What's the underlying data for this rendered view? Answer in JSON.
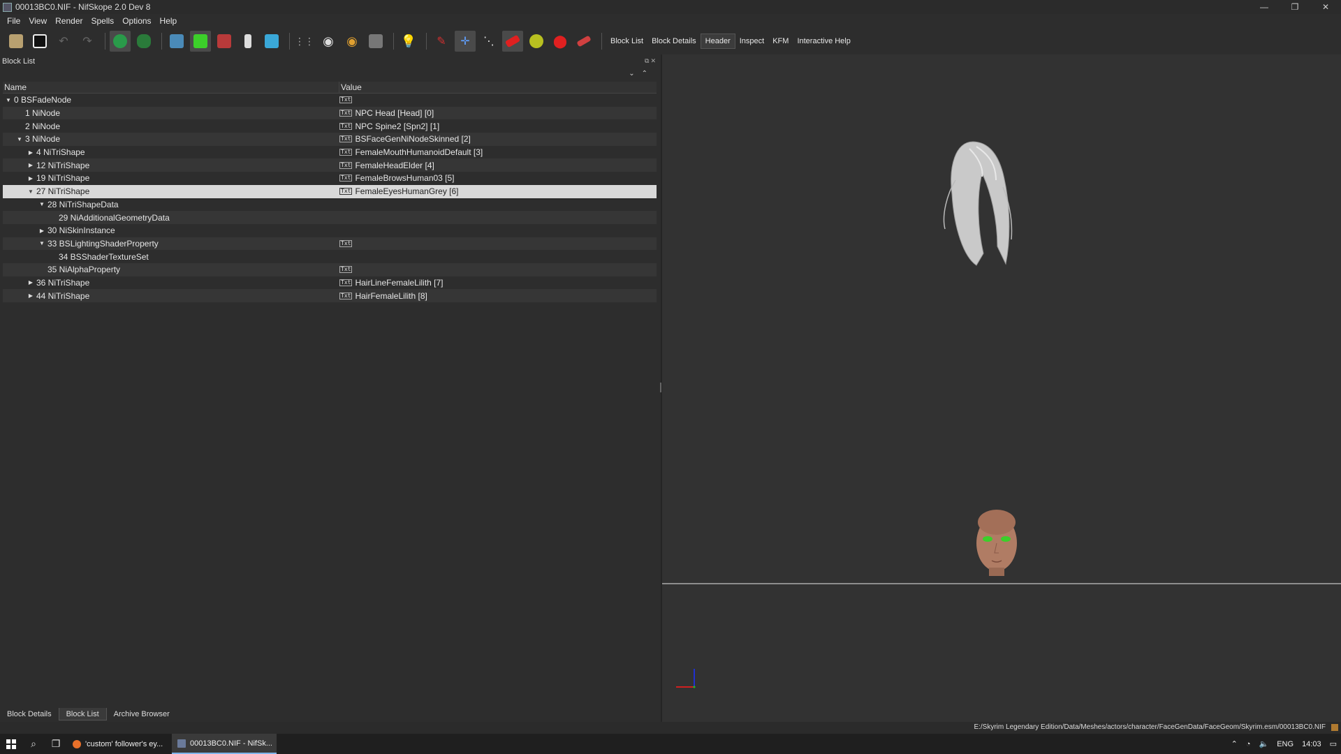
{
  "window": {
    "title": "00013BC0.NIF - NifSkope 2.0 Dev 8",
    "controls": [
      "—",
      "❐",
      "✕"
    ]
  },
  "menu": [
    "File",
    "View",
    "Render",
    "Spells",
    "Options",
    "Help"
  ],
  "toolbar": {
    "text_buttons": [
      "Block List",
      "Block Details",
      "Header",
      "Inspect",
      "KFM",
      "Interactive Help"
    ],
    "active_text_button": "Header"
  },
  "block_list": {
    "title": "Block List",
    "columns": {
      "name": "Name",
      "value": "Value"
    },
    "rows": [
      {
        "name": "0 BSFadeNode",
        "value": "",
        "icon": true,
        "arrow": "down",
        "level": 0
      },
      {
        "name": "1 NiNode",
        "value": "NPC Head [Head] [0]",
        "icon": true,
        "arrow": "",
        "level": 1
      },
      {
        "name": "2 NiNode",
        "value": "NPC Spine2 [Spn2] [1]",
        "icon": true,
        "arrow": "",
        "level": 1
      },
      {
        "name": "3 NiNode",
        "value": "BSFaceGenNiNodeSkinned [2]",
        "icon": true,
        "arrow": "down",
        "level": 1
      },
      {
        "name": "4 NiTriShape",
        "value": "FemaleMouthHumanoidDefault [3]",
        "icon": true,
        "arrow": "right",
        "level": 2
      },
      {
        "name": "12 NiTriShape",
        "value": "FemaleHeadElder [4]",
        "icon": true,
        "arrow": "right",
        "level": 2
      },
      {
        "name": "19 NiTriShape",
        "value": "FemaleBrowsHuman03 [5]",
        "icon": true,
        "arrow": "right",
        "level": 2
      },
      {
        "name": "27 NiTriShape",
        "value": "FemaleEyesHumanGrey [6]",
        "icon": true,
        "arrow": "down",
        "level": 2,
        "selected": true
      },
      {
        "name": "28 NiTriShapeData",
        "value": "",
        "icon": false,
        "arrow": "down",
        "level": 3
      },
      {
        "name": "29 NiAdditionalGeometryData",
        "value": "",
        "icon": false,
        "arrow": "",
        "level": 4
      },
      {
        "name": "30 NiSkinInstance",
        "value": "",
        "icon": false,
        "arrow": "right",
        "level": 3
      },
      {
        "name": "33 BSLightingShaderProperty",
        "value": "",
        "icon": true,
        "arrow": "down",
        "level": 3
      },
      {
        "name": "34 BSShaderTextureSet",
        "value": "",
        "icon": false,
        "arrow": "",
        "level": 4
      },
      {
        "name": "35 NiAlphaProperty",
        "value": "",
        "icon": true,
        "arrow": "",
        "level": 3
      },
      {
        "name": "36 NiTriShape",
        "value": "HairLineFemaleLilith [7]",
        "icon": true,
        "arrow": "right",
        "level": 2
      },
      {
        "name": "44 NiTriShape",
        "value": "HairFemaleLilith [8]",
        "icon": true,
        "arrow": "right",
        "level": 2
      }
    ]
  },
  "bottom_tabs": [
    "Block Details",
    "Block List",
    "Archive Browser"
  ],
  "active_bottom_tab": "Block List",
  "status": {
    "path": "E:/Skyrim Legendary Edition/Data/Meshes/actors/character/FaceGenData/FaceGeom/Skyrim.esm/00013BC0.NIF"
  },
  "taskbar": {
    "apps": [
      "'custom' follower's ey...",
      "00013BC0.NIF - NifSk..."
    ],
    "language": "ENG",
    "time": "14:03"
  },
  "colors": {
    "eyes": "#3ccf2a",
    "hair": "#c9c9c9",
    "skin": "#b07c64",
    "axis_x": "#d02020",
    "axis_y": "#2030d0"
  }
}
